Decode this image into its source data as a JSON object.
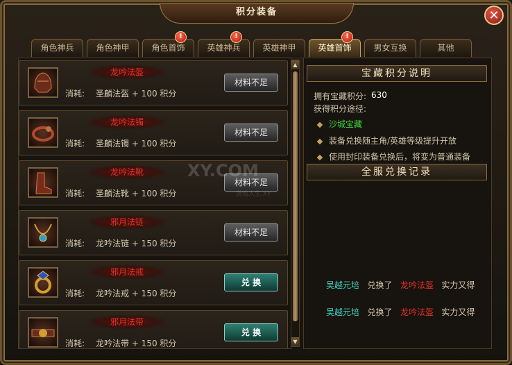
{
  "window": {
    "title": "积分装备",
    "close_icon": "close-icon"
  },
  "tabs": [
    {
      "label": "角色神兵",
      "active": false,
      "badge": ""
    },
    {
      "label": "角色神甲",
      "active": false,
      "badge": ""
    },
    {
      "label": "角色首饰",
      "active": false,
      "badge": "!"
    },
    {
      "label": "英雄神兵",
      "active": false,
      "badge": "!"
    },
    {
      "label": "英雄神甲",
      "active": false,
      "badge": ""
    },
    {
      "label": "英雄首饰",
      "active": true,
      "badge": "!"
    },
    {
      "label": "男女互换",
      "active": false,
      "badge": ""
    },
    {
      "label": "其他",
      "active": false,
      "badge": ""
    }
  ],
  "items": [
    {
      "name": "龙吟法盔",
      "cost_label": "消耗:",
      "cost": "圣麟法盔 + 100 积分",
      "button": "材料不足",
      "enabled": false,
      "icon": "helmet-icon"
    },
    {
      "name": "龙吟法镯",
      "cost_label": "消耗:",
      "cost": "圣麟法镯 + 100 积分",
      "button": "材料不足",
      "enabled": false,
      "icon": "bracelet-icon"
    },
    {
      "name": "龙吟法靴",
      "cost_label": "消耗:",
      "cost": "圣麟法靴 + 100 积分",
      "button": "材料不足",
      "enabled": false,
      "icon": "boots-icon"
    },
    {
      "name": "邪月法链",
      "cost_label": "消耗:",
      "cost": "龙吟法链 + 150 积分",
      "button": "材料不足",
      "enabled": false,
      "icon": "necklace-icon"
    },
    {
      "name": "邪月法戒",
      "cost_label": "消耗:",
      "cost": "龙吟法戒 + 150 积分",
      "button": "兑 换",
      "enabled": true,
      "icon": "ring-icon"
    },
    {
      "name": "邪月法带",
      "cost_label": "消耗:",
      "cost": "龙吟法带 + 150 积分",
      "button": "兑 换",
      "enabled": true,
      "icon": "belt-icon"
    }
  ],
  "info": {
    "header": "宝藏积分说明",
    "points_label": "拥有宝藏积分:",
    "points_value": "630",
    "ways_label": "获得积分途径:",
    "ways": [
      "沙城宝藏",
      "装备兑换随主角/英雄等级提升开放",
      "使用封印装备兑换后，将变为普通装备"
    ]
  },
  "records": {
    "header": "全服兑换记录",
    "entries": [
      {
        "player": "吴越元培",
        "action": "兑换了",
        "item": "龙吟法盔",
        "suffix": "实力又得"
      },
      {
        "player": "吴越元培",
        "action": "兑换了",
        "item": "龙吟法盔",
        "suffix": "实力又得"
      }
    ]
  },
  "watermark": {
    "text": "XY.COM",
    "sub": "游戏人生.XY"
  },
  "colors": {
    "accent_gold": "#c9a25a",
    "item_name_red": "#e0312a",
    "player_cyan": "#41d4c4",
    "green": "#3fd53f"
  }
}
